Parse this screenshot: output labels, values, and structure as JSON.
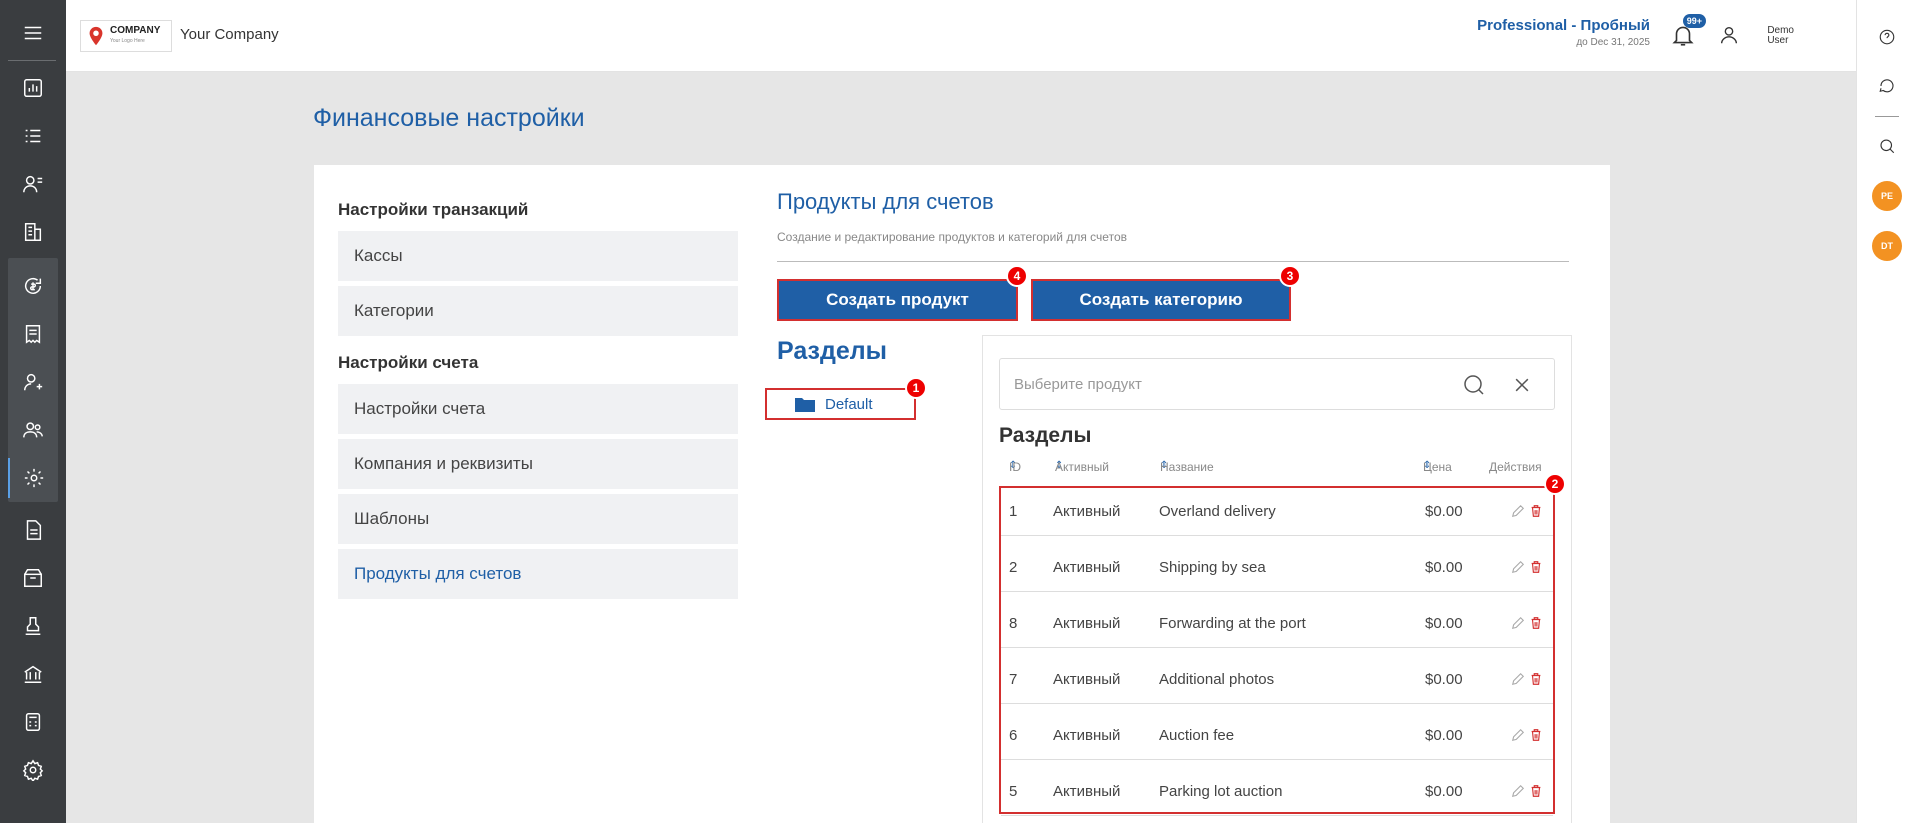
{
  "header": {
    "logo_text": "COMPANY",
    "logo_sub": "Your Logo Here",
    "company_name": "Your Company",
    "plan_name": "Professional - Пробный",
    "plan_date": "до Dec 31, 2025",
    "notif_badge": "99+",
    "user_first": "Demo",
    "user_last": "User"
  },
  "page": {
    "title": "Финансовые настройки"
  },
  "left_menu": {
    "section1": "Настройки транзакций",
    "section1_items": [
      "Кассы",
      "Категории"
    ],
    "section2": "Настройки счета",
    "section2_items": [
      "Настройки счета",
      "Компания и реквизиты",
      "Шаблоны",
      "Продукты для счетов"
    ]
  },
  "products": {
    "title": "Продукты для счетов",
    "subtitle": "Создание и редактирование продуктов и категорий для счетов",
    "create_product": "Создать продукт",
    "create_category": "Создать категорию",
    "badge_product": "4",
    "badge_category": "3"
  },
  "sections": {
    "title": "Разделы",
    "folder": "Default",
    "folder_badge": "1"
  },
  "table": {
    "search_placeholder": "Выберите продукт",
    "title": "Разделы",
    "rows_badge": "2",
    "columns": {
      "id": "ID",
      "active": "Активный",
      "name": "Название",
      "price": "Цена",
      "actions": "Действия"
    },
    "rows": [
      {
        "id": "1",
        "status": "Активный",
        "name": "Overland delivery",
        "price": "$0.00"
      },
      {
        "id": "2",
        "status": "Активный",
        "name": "Shipping by sea",
        "price": "$0.00"
      },
      {
        "id": "8",
        "status": "Активный",
        "name": "Forwarding at the port",
        "price": "$0.00"
      },
      {
        "id": "7",
        "status": "Активный",
        "name": "Additional photos",
        "price": "$0.00"
      },
      {
        "id": "6",
        "status": "Активный",
        "name": "Auction fee",
        "price": "$0.00"
      },
      {
        "id": "5",
        "status": "Активный",
        "name": "Parking lot auction",
        "price": "$0.00"
      }
    ]
  },
  "right_rail": {
    "avatar1": "PE",
    "avatar2": "DT"
  },
  "colors": {
    "brand": "#1f5fa6",
    "sidebar": "#3a3d40",
    "highlight": "#d32f2f",
    "avatar": "#f39222"
  }
}
